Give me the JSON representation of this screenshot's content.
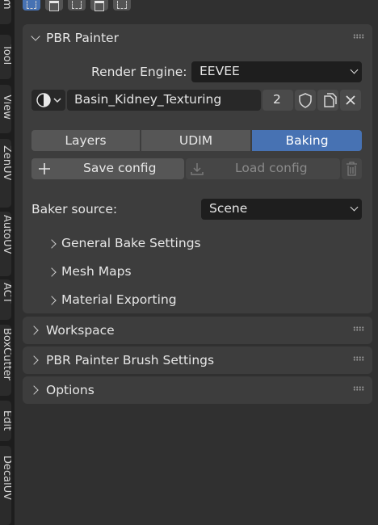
{
  "left_tabs": [
    "Item",
    "Tool",
    "View",
    "ZenUV",
    "AutoUV",
    "ACT",
    "BoxCutter",
    "Edit",
    "DecalUV"
  ],
  "top_icons": [
    "select-box-icon",
    "mode-extend-icon",
    "mode-subtract-icon",
    "mode-difference-icon",
    "mode-intersect-icon"
  ],
  "pbr_painter": {
    "title": "PBR Painter",
    "render_engine_label": "Render Engine:",
    "render_engine_value": "EEVEE",
    "material_name": "Basin_Kidney_Texturing",
    "user_count": "2",
    "tabs": [
      {
        "label": "Layers",
        "active": false
      },
      {
        "label": "UDIM",
        "active": false
      },
      {
        "label": "Baking",
        "active": true
      }
    ],
    "save_config": "Save config",
    "load_config": "Load config",
    "baker_source_label": "Baker source:",
    "baker_source_value": "Scene",
    "subpanels": [
      "General Bake Settings",
      "Mesh Maps",
      "Material Exporting"
    ]
  },
  "collapsed_panels": [
    "Workspace",
    "PBR Painter Brush Settings",
    "Options"
  ],
  "colors": {
    "accent": "#4772b3",
    "panel": "#3d3d3d",
    "background": "#303030",
    "field": "#1e1e1e",
    "button": "#565656"
  }
}
